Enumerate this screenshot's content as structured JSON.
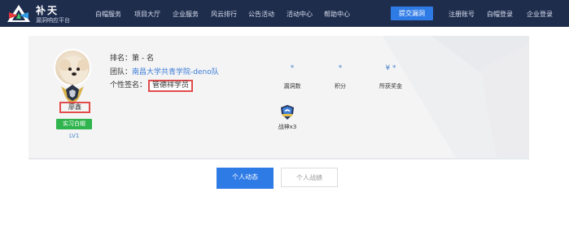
{
  "brand": {
    "name": "补天",
    "subtitle": "漏洞响应平台"
  },
  "nav": {
    "items": [
      "白帽服务",
      "项目大厅",
      "企业服务",
      "风云排行",
      "公告活动",
      "活动中心",
      "帮助中心"
    ],
    "submit_label": "提交漏洞",
    "right_items": [
      "注册账号",
      "白帽登录",
      "企业登录"
    ]
  },
  "profile": {
    "rank_prefix": "排名：",
    "rank_value": "第 - 名",
    "team_prefix": "团队：",
    "team_value": "南昌大学共青学院-deno队",
    "signature_prefix": "个性签名：",
    "signature_value": "管德祥学员",
    "nickname": "廖鑫",
    "tag": "实习白帽",
    "level": "LV1"
  },
  "stats": [
    {
      "value": "*",
      "label": "漏洞数"
    },
    {
      "value": "*",
      "label": "积分"
    },
    {
      "value": "¥ *",
      "label": "所获奖金"
    }
  ],
  "battle": {
    "label": "战神x3",
    "icon": "battle-shield-icon"
  },
  "tabs": {
    "active": "个人动态",
    "inactive": "个人战绩"
  },
  "colors": {
    "nav_bg": "#1f2d4d",
    "accent": "#2f7be6",
    "highlight_box": "#e24b4b",
    "tag_green": "#2fb44e",
    "link": "#3a7bd5"
  }
}
